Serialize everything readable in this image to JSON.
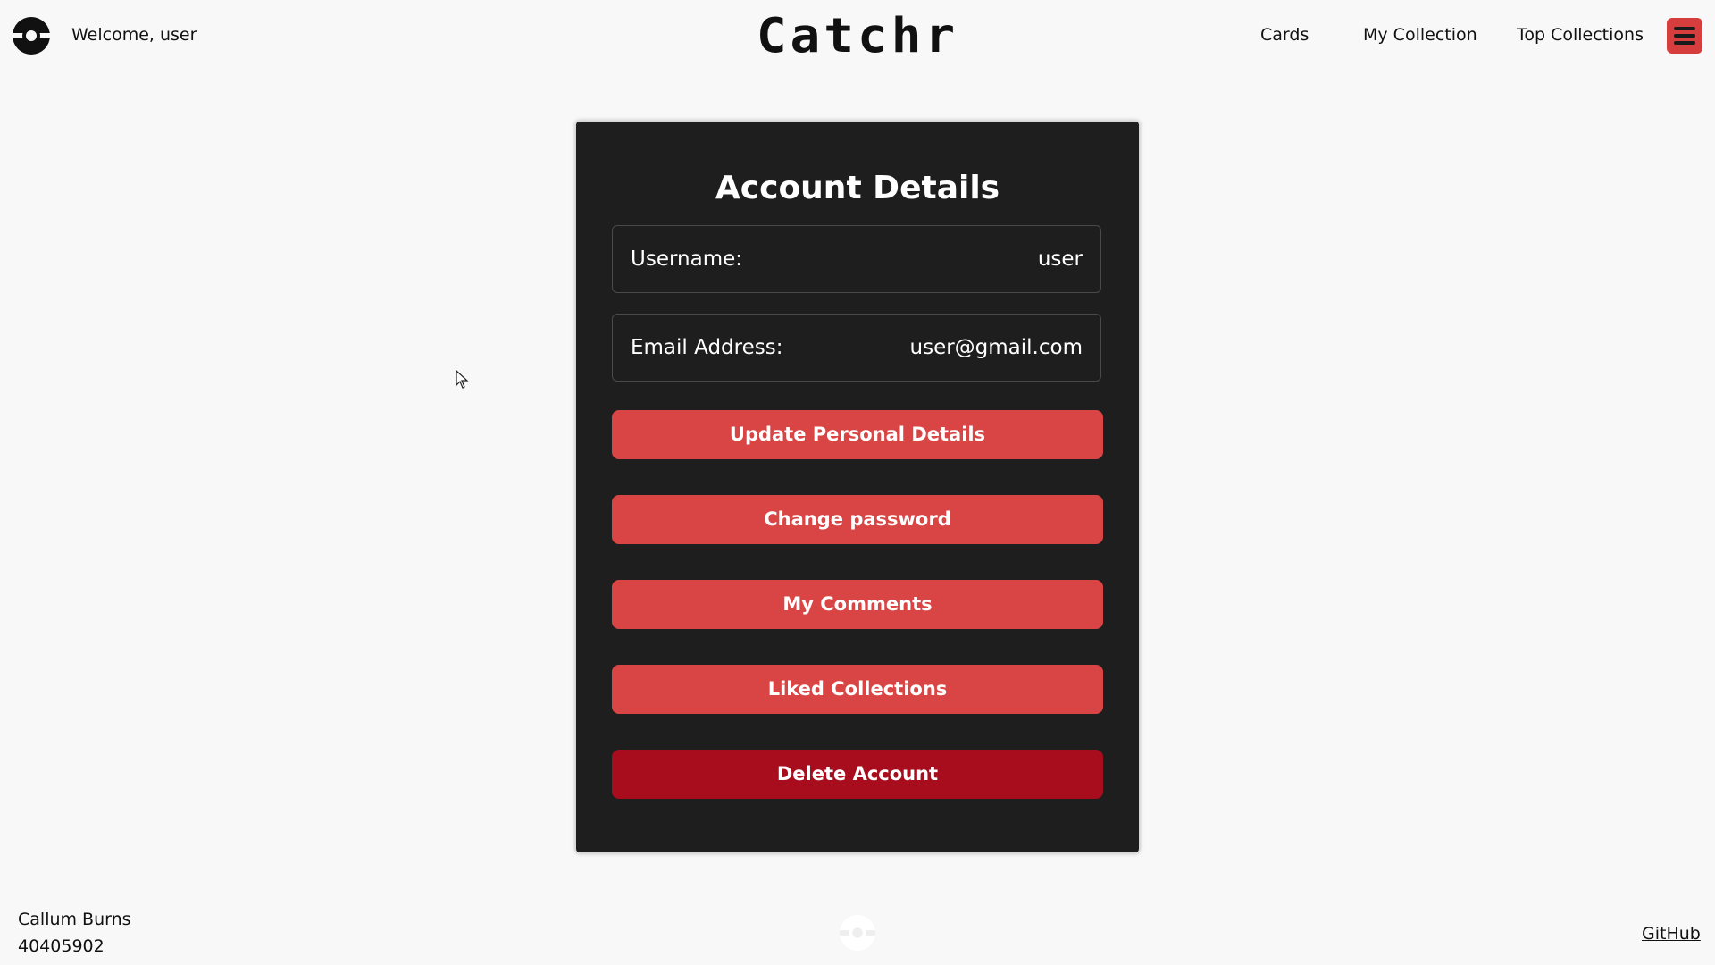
{
  "header": {
    "welcome_text": "Welcome, user",
    "brand": "Catchr",
    "nav": {
      "cards": "Cards",
      "my_collection": "My Collection",
      "top_collections": "Top Collections"
    },
    "logo_icon": "pokeball-icon",
    "menu_icon": "hamburger-menu-icon"
  },
  "account": {
    "title": "Account Details",
    "username_label": "Username:",
    "username_value": "user",
    "email_label": "Email Address:",
    "email_value": "user@gmail.com",
    "buttons": {
      "update": "Update Personal Details",
      "change_password": "Change password",
      "comments": "My Comments",
      "liked": "Liked Collections",
      "delete": "Delete Account"
    }
  },
  "footer": {
    "name": "Callum Burns",
    "id": "40405902",
    "github": "GitHub"
  },
  "colors": {
    "background": "#f8f8f8",
    "card": "#1e1e1e",
    "accent_red": "#d94444",
    "danger_red": "#a80d1e",
    "menu_button": "#d63d3d"
  }
}
